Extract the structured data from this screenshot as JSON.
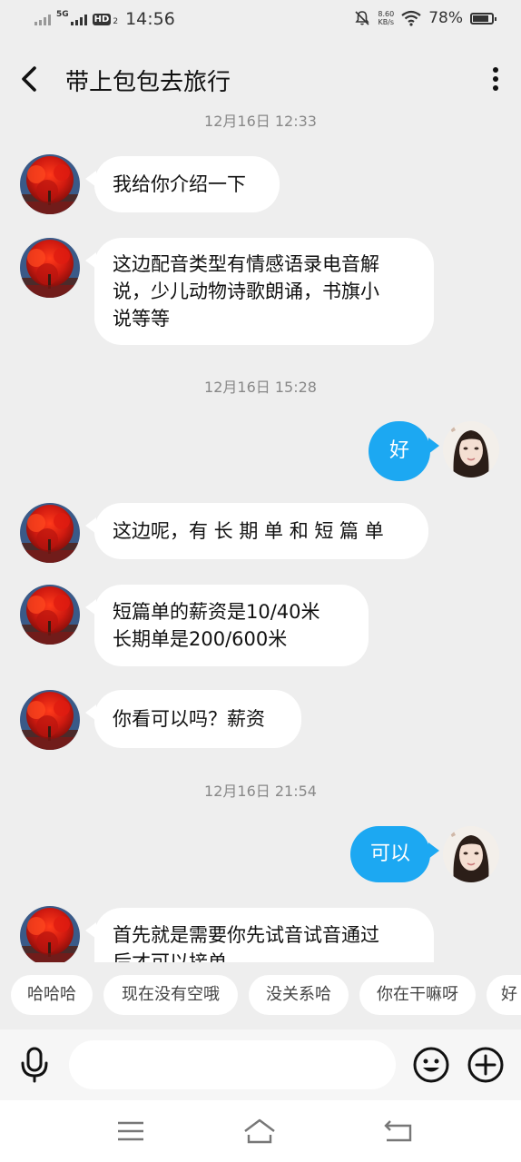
{
  "status_bar": {
    "network": "5G",
    "hd": "HD",
    "hd_sub": "2",
    "time": "14:56",
    "speed_value": "8.60",
    "speed_unit": "KB/s",
    "battery": "78%",
    "battery_level": 0.78
  },
  "header": {
    "title": "带上包包去旅行"
  },
  "timestamps": [
    "12月16日 12:33",
    "12月16日 15:28",
    "12月16日 21:54"
  ],
  "messages": [
    {
      "from": "other",
      "lines": [
        "我给你介绍一下"
      ]
    },
    {
      "from": "other",
      "lines": [
        "这边配音类型有情感语录电音解",
        "说，少儿动物诗歌朗诵，书旗小",
        "说等等"
      ]
    },
    {
      "from": "me",
      "lines": [
        "好"
      ]
    },
    {
      "from": "other",
      "lines": [
        "这边呢，有 长 期 单 和 短 篇 单"
      ]
    },
    {
      "from": "other",
      "lines": [
        "短篇单的薪资是10/40米",
        "长期单是200/600米"
      ]
    },
    {
      "from": "other",
      "lines": [
        "你看可以吗？薪资"
      ]
    },
    {
      "from": "me",
      "lines": [
        "可以"
      ]
    },
    {
      "from": "other",
      "lines": [
        "首先就是需要你先试音试音通过",
        "后才可以接单"
      ]
    }
  ],
  "quick_replies": [
    "哈哈哈",
    "现在没有空哦",
    "没关系哈",
    "你在干嘛呀",
    "好"
  ],
  "input": {
    "placeholder": "",
    "value": ""
  },
  "icons": {
    "back": "chevron-left-icon",
    "more": "more-vertical-icon",
    "mic": "microphone-icon",
    "emoji": "emoji-icon",
    "plus": "plus-circle-icon",
    "nav_menu": "menu-icon",
    "nav_home": "home-icon",
    "nav_back": "back-icon"
  },
  "colors": {
    "accent": "#1ca8f2",
    "background": "#eeeeee",
    "bubble_in": "#ffffff"
  }
}
